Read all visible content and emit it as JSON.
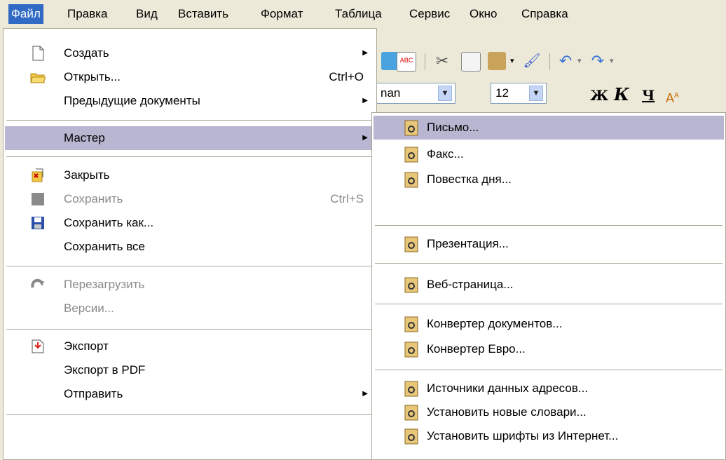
{
  "menubar": {
    "items": [
      "Файл",
      "Правка",
      "Вид",
      "Вставить",
      "Формат",
      "Таблица",
      "Сервис",
      "Окно",
      "Справка"
    ]
  },
  "toolbar": {
    "font_name_partial": "nan",
    "font_size": "12",
    "bold": "Ж",
    "italic": "К",
    "underline": "Ч"
  },
  "file_menu": {
    "items": [
      {
        "label": "Создать",
        "icon": "new-document-icon",
        "submenu": true
      },
      {
        "label": "Открыть...",
        "shortcut": "Ctrl+O",
        "icon": "open-folder-icon"
      },
      {
        "label": "Предыдущие документы",
        "submenu": true
      },
      {
        "label": "Мастер",
        "submenu": true,
        "highlighted": true
      },
      {
        "label": "Закрыть",
        "icon": "close-document-icon"
      },
      {
        "label": "Сохранить",
        "shortcut": "Ctrl+S",
        "disabled": true,
        "icon": "save-icon"
      },
      {
        "label": "Сохранить как...",
        "icon": "save-as-icon"
      },
      {
        "label": "Сохранить все"
      },
      {
        "label": "Перезагрузить",
        "disabled": true,
        "icon": "reload-icon"
      },
      {
        "label": "Версии...",
        "disabled": true
      },
      {
        "label": "Экспорт",
        "icon": "export-icon"
      },
      {
        "label": "Экспорт в PDF"
      },
      {
        "label": "Отправить",
        "submenu": true
      }
    ]
  },
  "wizard_menu": {
    "items": [
      "Письмо...",
      "Факс...",
      "Повестка дня...",
      "Презентация...",
      "Веб-страница...",
      "Конвертер документов...",
      "Конвертер Евро...",
      "Источники данных адресов...",
      "Установить новые словари...",
      "Установить шрифты из Интернет..."
    ]
  }
}
